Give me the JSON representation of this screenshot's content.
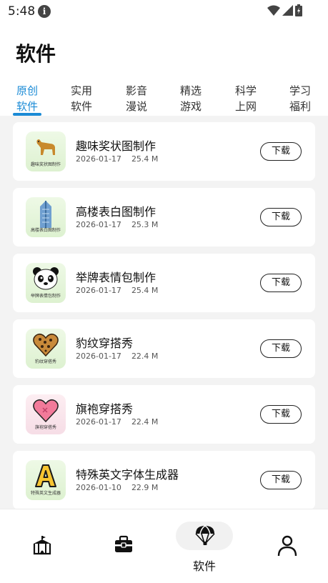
{
  "status_bar": {
    "time": "5:48"
  },
  "page": {
    "title": "软件"
  },
  "tabs": [
    {
      "line1": "原创",
      "line2": "软件",
      "active": true
    },
    {
      "line1": "实用",
      "line2": "软件",
      "active": false
    },
    {
      "line1": "影音",
      "line2": "漫说",
      "active": false
    },
    {
      "line1": "精选",
      "line2": "游戏",
      "active": false
    },
    {
      "line1": "科学",
      "line2": "上网",
      "active": false
    },
    {
      "line1": "学习",
      "line2": "福利",
      "active": false
    }
  ],
  "apps": [
    {
      "name": "趣味奖状图制作",
      "date": "2026-01-17",
      "size": "25.4 M",
      "icon": "dog-icon",
      "icon_caption": "趣味奖状图制作",
      "action": "下载"
    },
    {
      "name": "高楼表白图制作",
      "date": "2026-01-17",
      "size": "25.3 M",
      "icon": "skyscraper-icon",
      "icon_caption": "高楼表白图制作",
      "action": "下载"
    },
    {
      "name": "举牌表情包制作",
      "date": "2026-01-17",
      "size": "25.4 M",
      "icon": "panda-icon",
      "icon_caption": "举牌表情包制作",
      "action": "下载"
    },
    {
      "name": "豹纹穿搭秀",
      "date": "2026-01-17",
      "size": "22.4 M",
      "icon": "leopard-heart-icon",
      "icon_caption": "豹纹穿搭秀",
      "action": "下载"
    },
    {
      "name": "旗袍穿搭秀",
      "date": "2026-01-17",
      "size": "22.4 M",
      "icon": "pink-heart-icon",
      "icon_caption": "旗袍穿搭秀",
      "action": "下载"
    },
    {
      "name": "特殊英文字体生成器",
      "date": "2026-01-10",
      "size": "22.9 M",
      "icon": "letter-a-icon",
      "icon_caption": "特殊英文生成器",
      "action": "下载"
    }
  ],
  "bottom_nav": [
    {
      "icon": "circus-tent-icon",
      "label": ""
    },
    {
      "icon": "toolbox-icon",
      "label": ""
    },
    {
      "icon": "parachute-icon",
      "label": "软件",
      "active": true
    },
    {
      "icon": "person-icon",
      "label": ""
    }
  ]
}
